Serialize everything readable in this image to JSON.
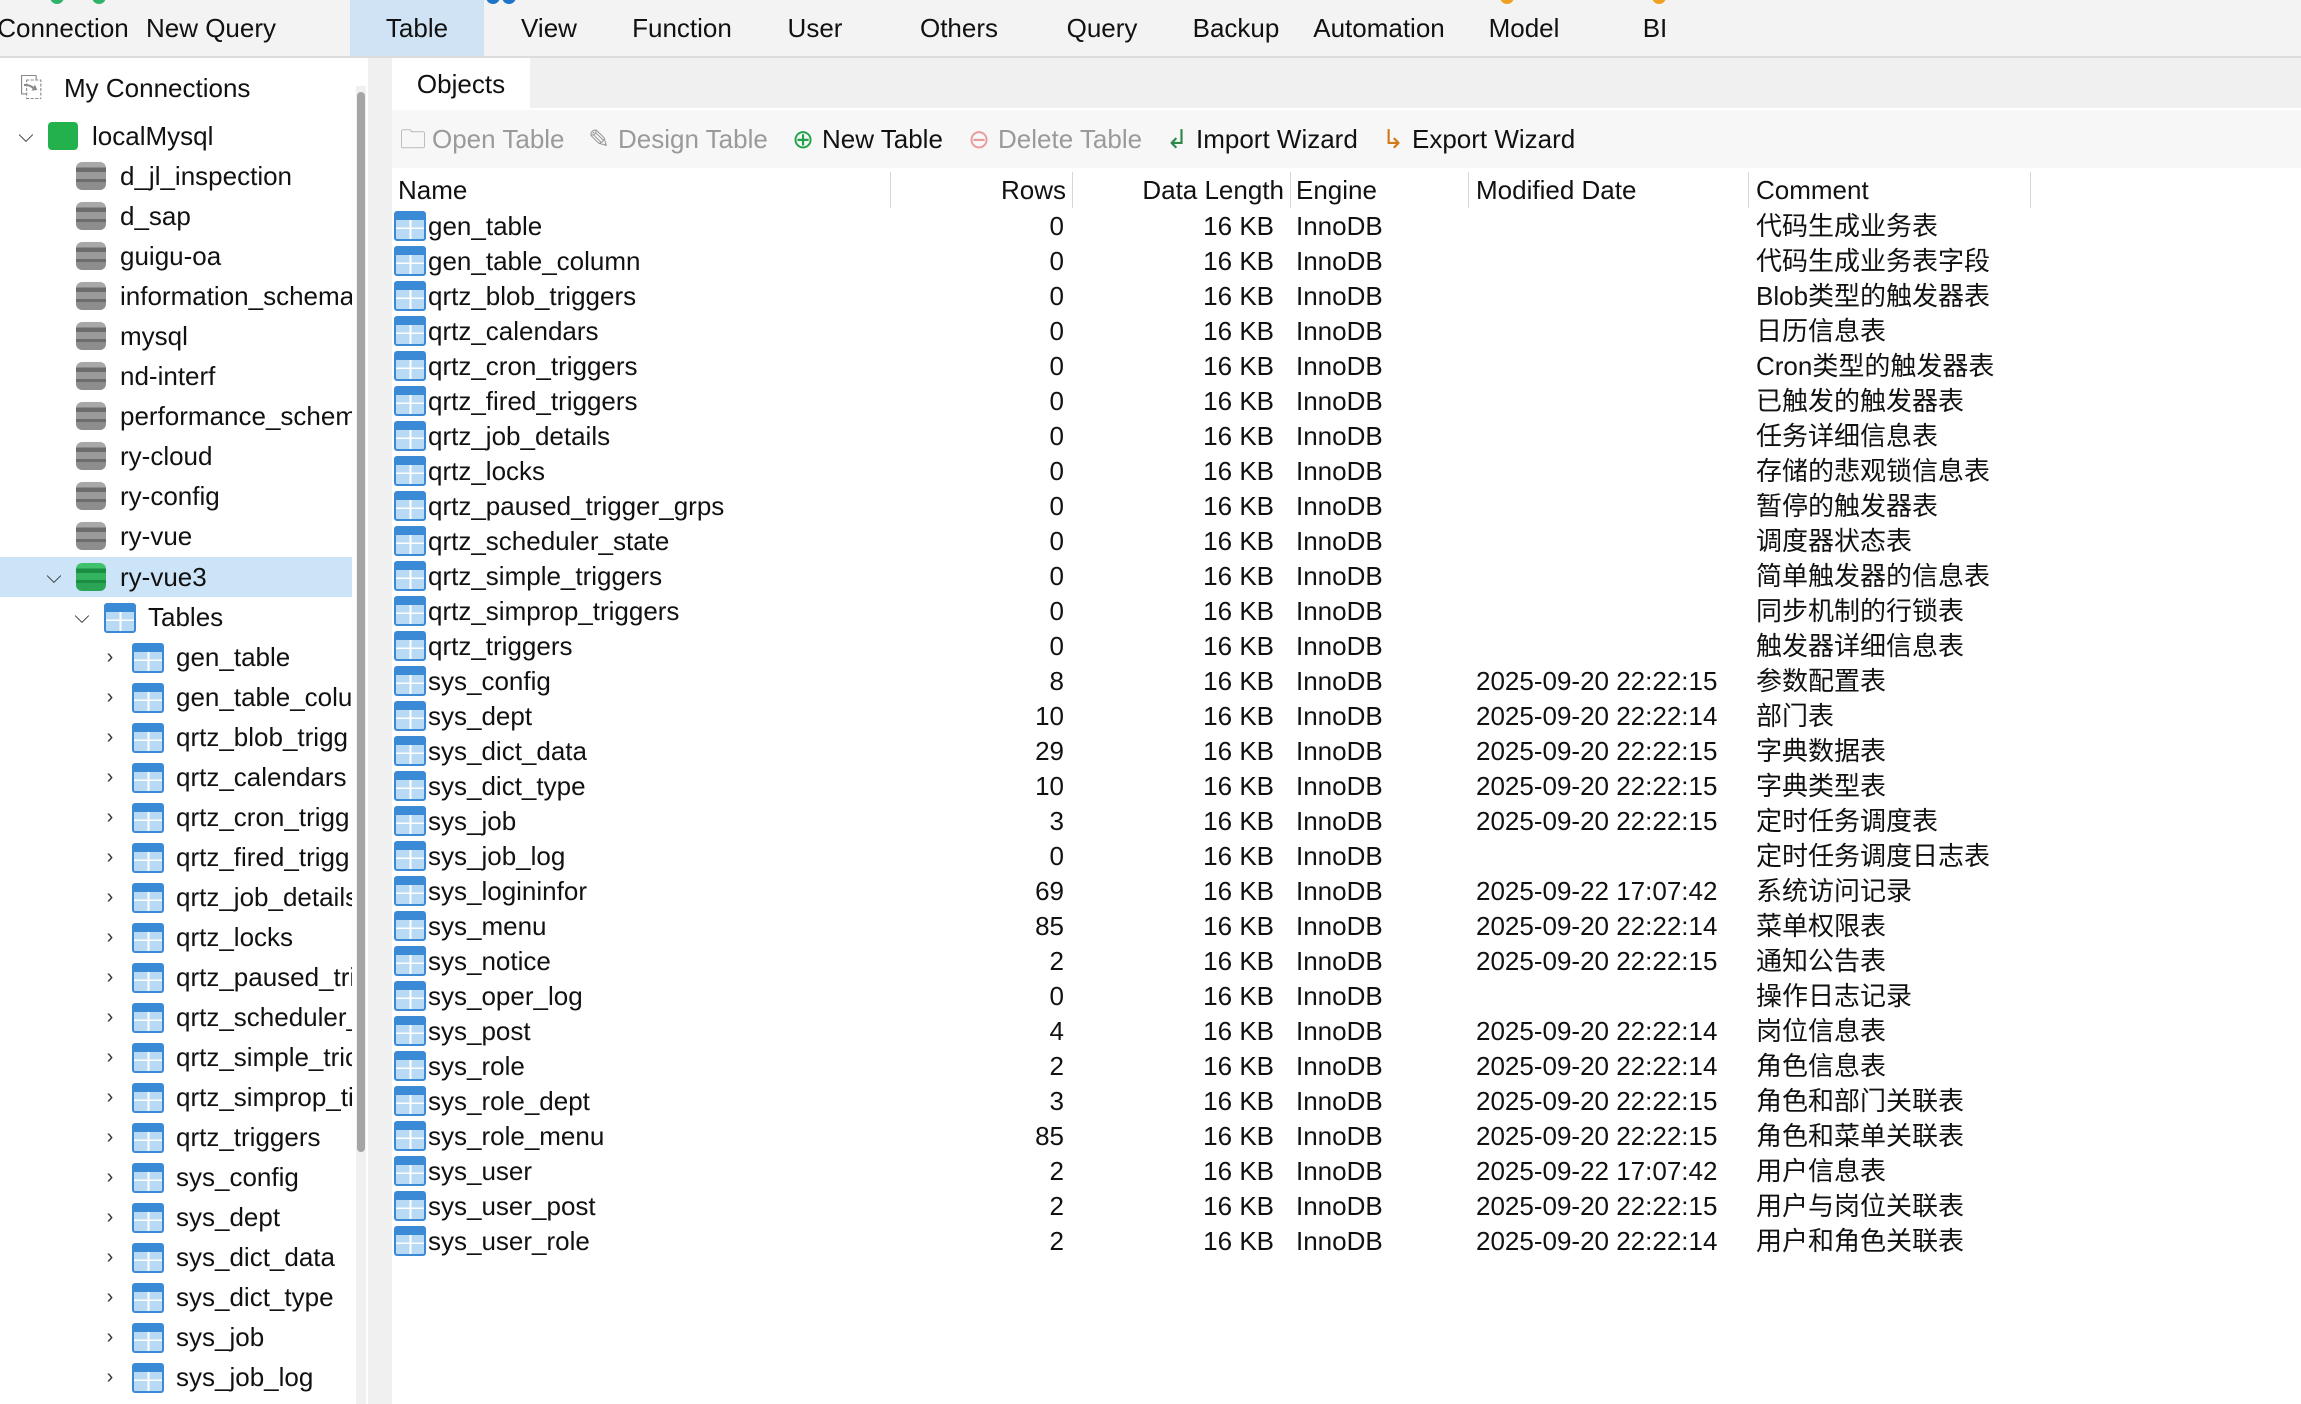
{
  "ribbon": {
    "items": [
      {
        "label": "Connection",
        "active": false
      },
      {
        "label": "New Query",
        "active": false
      },
      {
        "label": "Table",
        "active": true
      },
      {
        "label": "View",
        "active": false
      },
      {
        "label": "Function",
        "active": false
      },
      {
        "label": "User",
        "active": false
      },
      {
        "label": "Others",
        "active": false
      },
      {
        "label": "Query",
        "active": false
      },
      {
        "label": "Backup",
        "active": false
      },
      {
        "label": "Automation",
        "active": false
      },
      {
        "label": "Model",
        "active": false
      },
      {
        "label": "BI",
        "active": false
      }
    ]
  },
  "sidebar": {
    "root_label": "My Connections",
    "connection": "localMysql",
    "databases": [
      "d_jl_inspection",
      "d_sap",
      "guigu-oa",
      "information_schema",
      "mysql",
      "nd-interf",
      "performance_schem",
      "ry-cloud",
      "ry-config",
      "ry-vue"
    ],
    "open_database": "ry-vue3",
    "tables_folder": "Tables",
    "tables": [
      "gen_table",
      "gen_table_colu",
      "qrtz_blob_trigg",
      "qrtz_calendars",
      "qrtz_cron_trigg",
      "qrtz_fired_trigg",
      "qrtz_job_details",
      "qrtz_locks",
      "qrtz_paused_tri",
      "qrtz_scheduler_",
      "qrtz_simple_tric",
      "qrtz_simprop_ti",
      "qrtz_triggers",
      "sys_config",
      "sys_dept",
      "sys_dict_data",
      "sys_dict_type",
      "sys_job",
      "sys_job_log"
    ]
  },
  "main": {
    "tab": "Objects",
    "toolbar": {
      "open_table": "Open Table",
      "design_table": "Design Table",
      "new_table": "New Table",
      "delete_table": "Delete Table",
      "import_wizard": "Import Wizard",
      "export_wizard": "Export Wizard"
    },
    "columns": {
      "name": "Name",
      "rows": "Rows",
      "data_length": "Data Length",
      "engine": "Engine",
      "modified": "Modified Date",
      "comment": "Comment"
    },
    "rows": [
      {
        "name": "gen_table",
        "rows": "0",
        "size": "16 KB",
        "engine": "InnoDB",
        "modified": "",
        "comment": "代码生成业务表"
      },
      {
        "name": "gen_table_column",
        "rows": "0",
        "size": "16 KB",
        "engine": "InnoDB",
        "modified": "",
        "comment": "代码生成业务表字段"
      },
      {
        "name": "qrtz_blob_triggers",
        "rows": "0",
        "size": "16 KB",
        "engine": "InnoDB",
        "modified": "",
        "comment": "Blob类型的触发器表"
      },
      {
        "name": "qrtz_calendars",
        "rows": "0",
        "size": "16 KB",
        "engine": "InnoDB",
        "modified": "",
        "comment": "日历信息表"
      },
      {
        "name": "qrtz_cron_triggers",
        "rows": "0",
        "size": "16 KB",
        "engine": "InnoDB",
        "modified": "",
        "comment": "Cron类型的触发器表"
      },
      {
        "name": "qrtz_fired_triggers",
        "rows": "0",
        "size": "16 KB",
        "engine": "InnoDB",
        "modified": "",
        "comment": "已触发的触发器表"
      },
      {
        "name": "qrtz_job_details",
        "rows": "0",
        "size": "16 KB",
        "engine": "InnoDB",
        "modified": "",
        "comment": "任务详细信息表"
      },
      {
        "name": "qrtz_locks",
        "rows": "0",
        "size": "16 KB",
        "engine": "InnoDB",
        "modified": "",
        "comment": "存储的悲观锁信息表"
      },
      {
        "name": "qrtz_paused_trigger_grps",
        "rows": "0",
        "size": "16 KB",
        "engine": "InnoDB",
        "modified": "",
        "comment": "暂停的触发器表"
      },
      {
        "name": "qrtz_scheduler_state",
        "rows": "0",
        "size": "16 KB",
        "engine": "InnoDB",
        "modified": "",
        "comment": "调度器状态表"
      },
      {
        "name": "qrtz_simple_triggers",
        "rows": "0",
        "size": "16 KB",
        "engine": "InnoDB",
        "modified": "",
        "comment": "简单触发器的信息表"
      },
      {
        "name": "qrtz_simprop_triggers",
        "rows": "0",
        "size": "16 KB",
        "engine": "InnoDB",
        "modified": "",
        "comment": "同步机制的行锁表"
      },
      {
        "name": "qrtz_triggers",
        "rows": "0",
        "size": "16 KB",
        "engine": "InnoDB",
        "modified": "",
        "comment": "触发器详细信息表"
      },
      {
        "name": "sys_config",
        "rows": "8",
        "size": "16 KB",
        "engine": "InnoDB",
        "modified": "2025-09-20 22:22:15",
        "comment": "参数配置表"
      },
      {
        "name": "sys_dept",
        "rows": "10",
        "size": "16 KB",
        "engine": "InnoDB",
        "modified": "2025-09-20 22:22:14",
        "comment": "部门表"
      },
      {
        "name": "sys_dict_data",
        "rows": "29",
        "size": "16 KB",
        "engine": "InnoDB",
        "modified": "2025-09-20 22:22:15",
        "comment": "字典数据表"
      },
      {
        "name": "sys_dict_type",
        "rows": "10",
        "size": "16 KB",
        "engine": "InnoDB",
        "modified": "2025-09-20 22:22:15",
        "comment": "字典类型表"
      },
      {
        "name": "sys_job",
        "rows": "3",
        "size": "16 KB",
        "engine": "InnoDB",
        "modified": "2025-09-20 22:22:15",
        "comment": "定时任务调度表"
      },
      {
        "name": "sys_job_log",
        "rows": "0",
        "size": "16 KB",
        "engine": "InnoDB",
        "modified": "",
        "comment": "定时任务调度日志表"
      },
      {
        "name": "sys_logininfor",
        "rows": "69",
        "size": "16 KB",
        "engine": "InnoDB",
        "modified": "2025-09-22 17:07:42",
        "comment": "系统访问记录"
      },
      {
        "name": "sys_menu",
        "rows": "85",
        "size": "16 KB",
        "engine": "InnoDB",
        "modified": "2025-09-20 22:22:14",
        "comment": "菜单权限表"
      },
      {
        "name": "sys_notice",
        "rows": "2",
        "size": "16 KB",
        "engine": "InnoDB",
        "modified": "2025-09-20 22:22:15",
        "comment": "通知公告表"
      },
      {
        "name": "sys_oper_log",
        "rows": "0",
        "size": "16 KB",
        "engine": "InnoDB",
        "modified": "",
        "comment": "操作日志记录"
      },
      {
        "name": "sys_post",
        "rows": "4",
        "size": "16 KB",
        "engine": "InnoDB",
        "modified": "2025-09-20 22:22:14",
        "comment": "岗位信息表"
      },
      {
        "name": "sys_role",
        "rows": "2",
        "size": "16 KB",
        "engine": "InnoDB",
        "modified": "2025-09-20 22:22:14",
        "comment": "角色信息表"
      },
      {
        "name": "sys_role_dept",
        "rows": "3",
        "size": "16 KB",
        "engine": "InnoDB",
        "modified": "2025-09-20 22:22:15",
        "comment": "角色和部门关联表"
      },
      {
        "name": "sys_role_menu",
        "rows": "85",
        "size": "16 KB",
        "engine": "InnoDB",
        "modified": "2025-09-20 22:22:15",
        "comment": "角色和菜单关联表"
      },
      {
        "name": "sys_user",
        "rows": "2",
        "size": "16 KB",
        "engine": "InnoDB",
        "modified": "2025-09-22 17:07:42",
        "comment": "用户信息表"
      },
      {
        "name": "sys_user_post",
        "rows": "2",
        "size": "16 KB",
        "engine": "InnoDB",
        "modified": "2025-09-20 22:22:15",
        "comment": "用户与岗位关联表"
      },
      {
        "name": "sys_user_role",
        "rows": "2",
        "size": "16 KB",
        "engine": "InnoDB",
        "modified": "2025-09-20 22:22:14",
        "comment": "用户和角色关联表"
      }
    ]
  },
  "colors": {
    "accent": "#3b8ad6",
    "selected_row": "#cce4f7",
    "active_tab": "#cfe3f5",
    "add_green": "#21a34a",
    "disabled": "#9a9a9a"
  }
}
